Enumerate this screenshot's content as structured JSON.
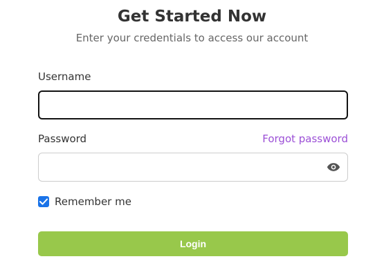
{
  "header": {
    "title": "Get Started Now",
    "subtitle": "Enter your credentials to access our account"
  },
  "form": {
    "username_label": "Username",
    "username_value": "",
    "password_label": "Password",
    "password_value": "",
    "forgot_password_link": "Forgot password",
    "show_password_icon": "eye-icon",
    "remember_me_label": "Remember me",
    "remember_me_checked": true,
    "login_button_label": "Login"
  },
  "colors": {
    "accent_green": "#98c84b",
    "link_purple": "#9b4fd6",
    "checkbox_blue": "#1a73e8"
  }
}
